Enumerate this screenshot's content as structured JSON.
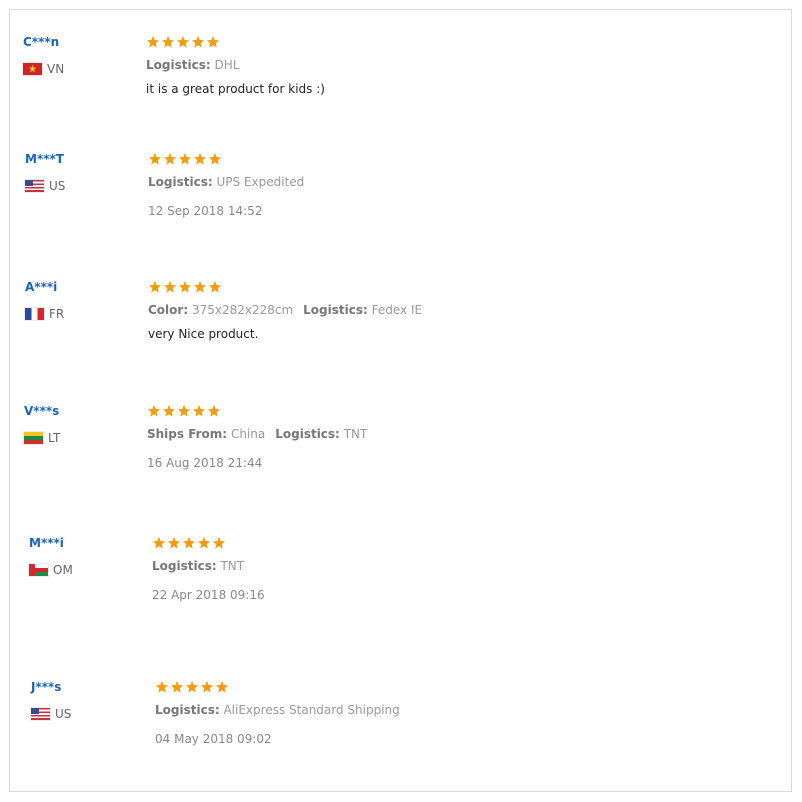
{
  "reviews": [
    {
      "user": "C***n",
      "country": "VN",
      "flag_icon": "vietnam-flag-icon",
      "rating": 5,
      "attributes": [
        {
          "label": "Logistics:",
          "value": "DHL"
        }
      ],
      "feedback": "it is a great product for kids :)",
      "date": ""
    },
    {
      "user": "M***T",
      "country": "US",
      "flag_icon": "usa-flag-icon",
      "rating": 5,
      "attributes": [
        {
          "label": "Logistics:",
          "value": "UPS Expedited"
        }
      ],
      "feedback": "",
      "date": "12 Sep 2018 14:52"
    },
    {
      "user": "A***i",
      "country": "FR",
      "flag_icon": "france-flag-icon",
      "rating": 5,
      "attributes": [
        {
          "label": "Color:",
          "value": "375x282x228cm"
        },
        {
          "label": "Logistics:",
          "value": "Fedex IE"
        }
      ],
      "feedback": "very Nice product.",
      "date": ""
    },
    {
      "user": "V***s",
      "country": "LT",
      "flag_icon": "lithuania-flag-icon",
      "rating": 5,
      "attributes": [
        {
          "label": "Ships From:",
          "value": "China"
        },
        {
          "label": "Logistics:",
          "value": "TNT"
        }
      ],
      "feedback": "",
      "date": "16 Aug 2018 21:44"
    },
    {
      "user": "M***i",
      "country": "OM",
      "flag_icon": "oman-flag-icon",
      "rating": 5,
      "attributes": [
        {
          "label": "Logistics:",
          "value": "TNT"
        }
      ],
      "feedback": "",
      "date": "22 Apr 2018 09:16"
    },
    {
      "user": "J***s",
      "country": "US",
      "flag_icon": "usa-flag-icon",
      "rating": 5,
      "attributes": [
        {
          "label": "Logistics:",
          "value": "AliExpress Standard Shipping"
        }
      ],
      "feedback": "",
      "date": "04 May 2018 09:02"
    }
  ],
  "colors": {
    "username": "#1a63bb",
    "star": "#f39c12",
    "label": "#777777",
    "value": "#999999"
  }
}
